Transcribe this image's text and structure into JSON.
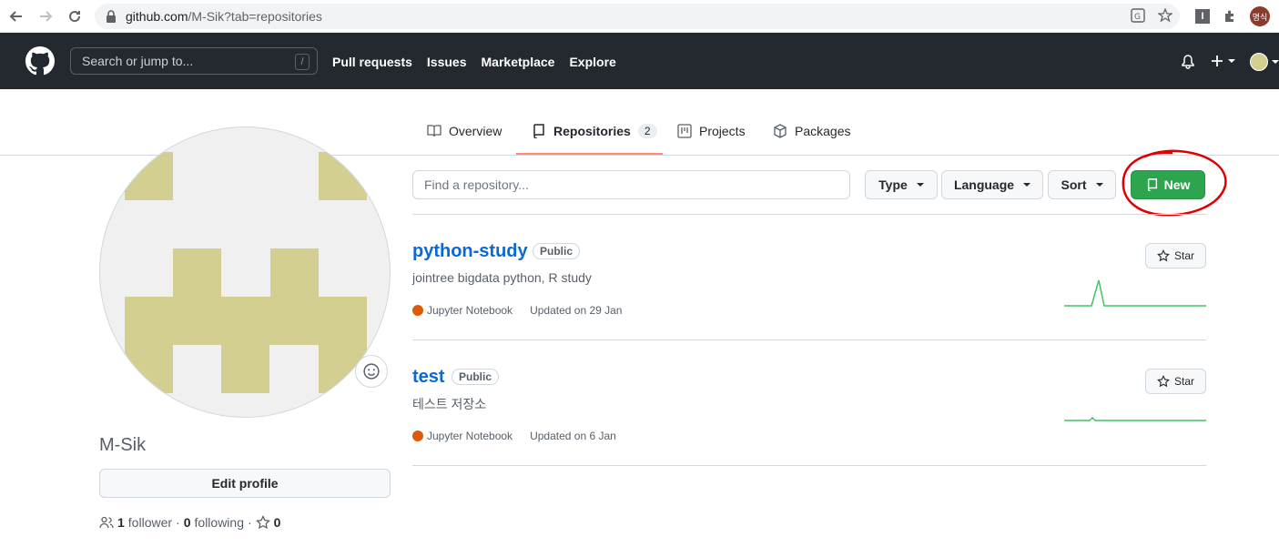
{
  "browser": {
    "url_host": "github.com",
    "url_path": "/M-Sik?tab=repositories",
    "profile_label": "명식"
  },
  "header": {
    "search_placeholder": "Search or jump to...",
    "search_shortcut": "/",
    "nav": [
      "Pull requests",
      "Issues",
      "Marketplace",
      "Explore"
    ]
  },
  "tabs": [
    {
      "label": "Overview",
      "icon": "book-icon"
    },
    {
      "label": "Repositories",
      "icon": "repo-icon",
      "count": "2",
      "active": true
    },
    {
      "label": "Projects",
      "icon": "project-icon"
    },
    {
      "label": "Packages",
      "icon": "package-icon"
    }
  ],
  "profile": {
    "username": "M-Sik",
    "edit_label": "Edit profile",
    "followers": "1",
    "followers_label": "follower",
    "separator": "·",
    "following": "0",
    "following_label": "following",
    "stars": "0"
  },
  "filters": {
    "find_placeholder": "Find a repository...",
    "type_label": "Type",
    "language_label": "Language",
    "sort_label": "Sort",
    "new_label": "New"
  },
  "repos": [
    {
      "name": "python-study",
      "visibility": "Public",
      "description": "jointree bigdata python, R study",
      "language": "Jupyter Notebook",
      "updated": "Updated on 29 Jan",
      "star_label": "Star"
    },
    {
      "name": "test",
      "visibility": "Public",
      "description": "테스트 저장소",
      "language": "Jupyter Notebook",
      "updated": "Updated on 6 Jan",
      "star_label": "Star"
    }
  ],
  "colors": {
    "header_bg": "#24292f",
    "link": "#0969da",
    "new_button": "#2da44e",
    "tab_underline": "#fd8c73",
    "jupyter": "#da5b0b",
    "annotation": "#e00000",
    "identicon": "#d3cf91"
  }
}
